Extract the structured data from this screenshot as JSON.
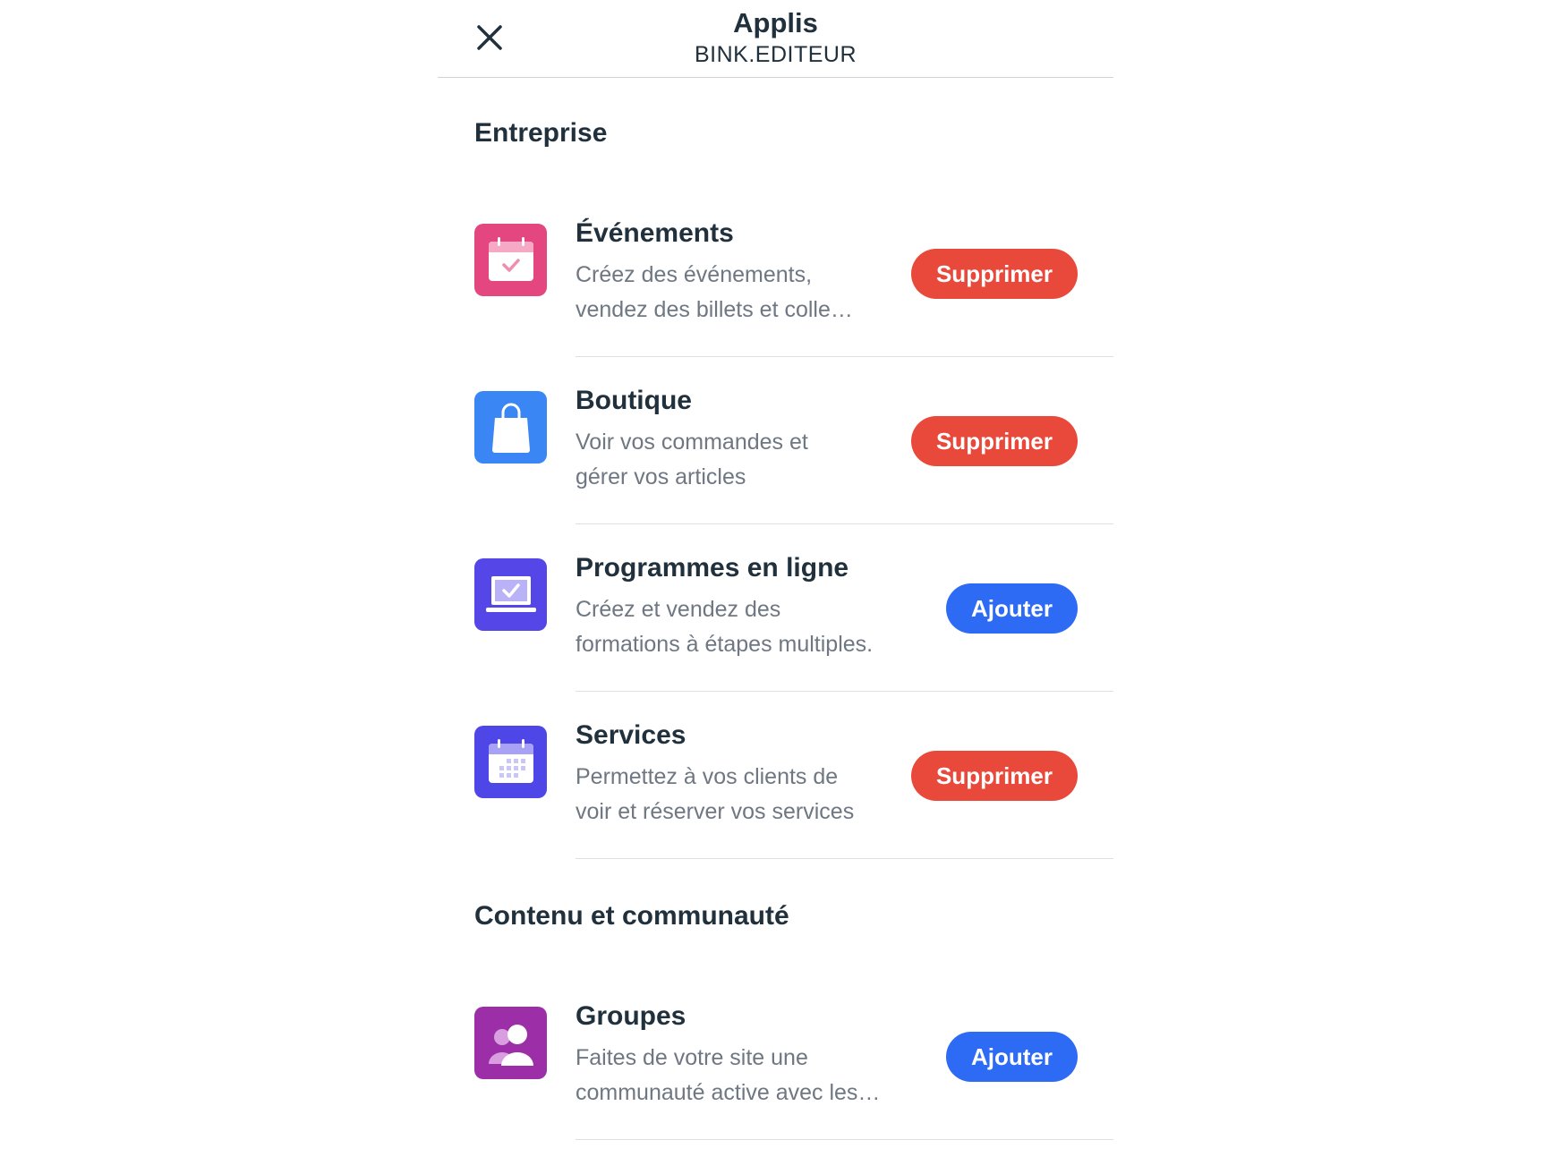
{
  "header": {
    "title": "Applis",
    "subtitle": "BINK.EDITEUR",
    "close_icon": "close-icon"
  },
  "sections": [
    {
      "title": "Entreprise",
      "items": [
        {
          "name": "Événements",
          "desc_line1": "Créez des événements,",
          "desc_line2": "vendez des billets et colle…",
          "button": "Supprimer",
          "icon": "calendar-check-icon",
          "icon_color": "#e4477f"
        },
        {
          "name": "Boutique",
          "desc_line1": "Voir vos commandes et",
          "desc_line2": "gérer vos articles",
          "button": "Supprimer",
          "icon": "shopping-bag-icon",
          "icon_color": "#3a86f4"
        },
        {
          "name": "Programmes en ligne",
          "desc_line1": "Créez et vendez des",
          "desc_line2": "formations à étapes multiples.",
          "button": "Ajouter",
          "icon": "laptop-check-icon",
          "icon_color": "#5546e8"
        },
        {
          "name": "Services",
          "desc_line1": "Permettez à vos clients de",
          "desc_line2": "voir et réserver vos services",
          "button": "Supprimer",
          "icon": "calendar-grid-icon",
          "icon_color": "#4f46e8"
        }
      ]
    },
    {
      "title": "Contenu et communauté",
      "items": [
        {
          "name": "Groupes",
          "desc_line1": "Faites de votre site une",
          "desc_line2": "communauté active avec les…",
          "button": "Ajouter",
          "icon": "people-icon",
          "icon_color": "#9c2fa8"
        }
      ]
    }
  ],
  "colors": {
    "remove_button": "#e8493a",
    "add_button": "#2d6bf5",
    "text_primary": "#20303c",
    "text_secondary": "#6e7782"
  }
}
